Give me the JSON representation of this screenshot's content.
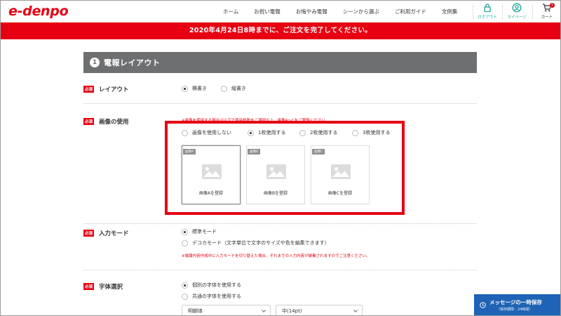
{
  "header": {
    "logo": "e-denpo",
    "nav": [
      "ホーム",
      "お祝い電報",
      "お悔やみ電報",
      "シーンから選ぶ",
      "ご利用ガイド",
      "文例集"
    ],
    "logout_label": "ログアウト",
    "mypage_label": "マイページ",
    "cart_label": "カート",
    "cart_count": "1"
  },
  "banner": "2020年4月24日8時までに、ご注文を完了してください。",
  "section": {
    "number": "1",
    "title": "電報レイアウト"
  },
  "required_label": "必須",
  "layout": {
    "label": "レイアウト",
    "options": [
      "横書き",
      "縦書き"
    ],
    "selected": 0
  },
  "image_use": {
    "label": "画像の使用",
    "note": "※画像を使用する場合は以下で使用枚数をご選択の上、画像A〜Cをご登録ください",
    "options": [
      "画像を使用しない",
      "1枚使用する",
      "2枚使用する",
      "3枚使用する"
    ],
    "selected": 1,
    "cards": [
      {
        "tag": "画像A",
        "label": "画像Aを登録"
      },
      {
        "tag": "画像B",
        "label": "画像Bを登録"
      },
      {
        "tag": "画像C",
        "label": "画像Cを登録"
      }
    ]
  },
  "input_mode": {
    "label": "入力モード",
    "options": [
      "標準モード",
      "デコカモード（文字単位で文字のサイズや色を編集できます）"
    ],
    "selected": 0,
    "note": "※電報内容作成中に入力モードを切り替えた場合、それまでの入力内容が破棄されますのでご注意ください。"
  },
  "font": {
    "label": "字体選択",
    "options": [
      "個別の字体を使用する",
      "共通の字体を使用する"
    ],
    "selected": 0,
    "font_select": "明朝体",
    "size_select": "中(14pt)"
  },
  "save_button": {
    "label": "メッセージの一時保存",
    "sub": "（保存期限：24時間）"
  },
  "colors": {
    "brand_red": "#e60012",
    "section_gray": "#6e6f70",
    "save_blue": "#1e63b5"
  }
}
